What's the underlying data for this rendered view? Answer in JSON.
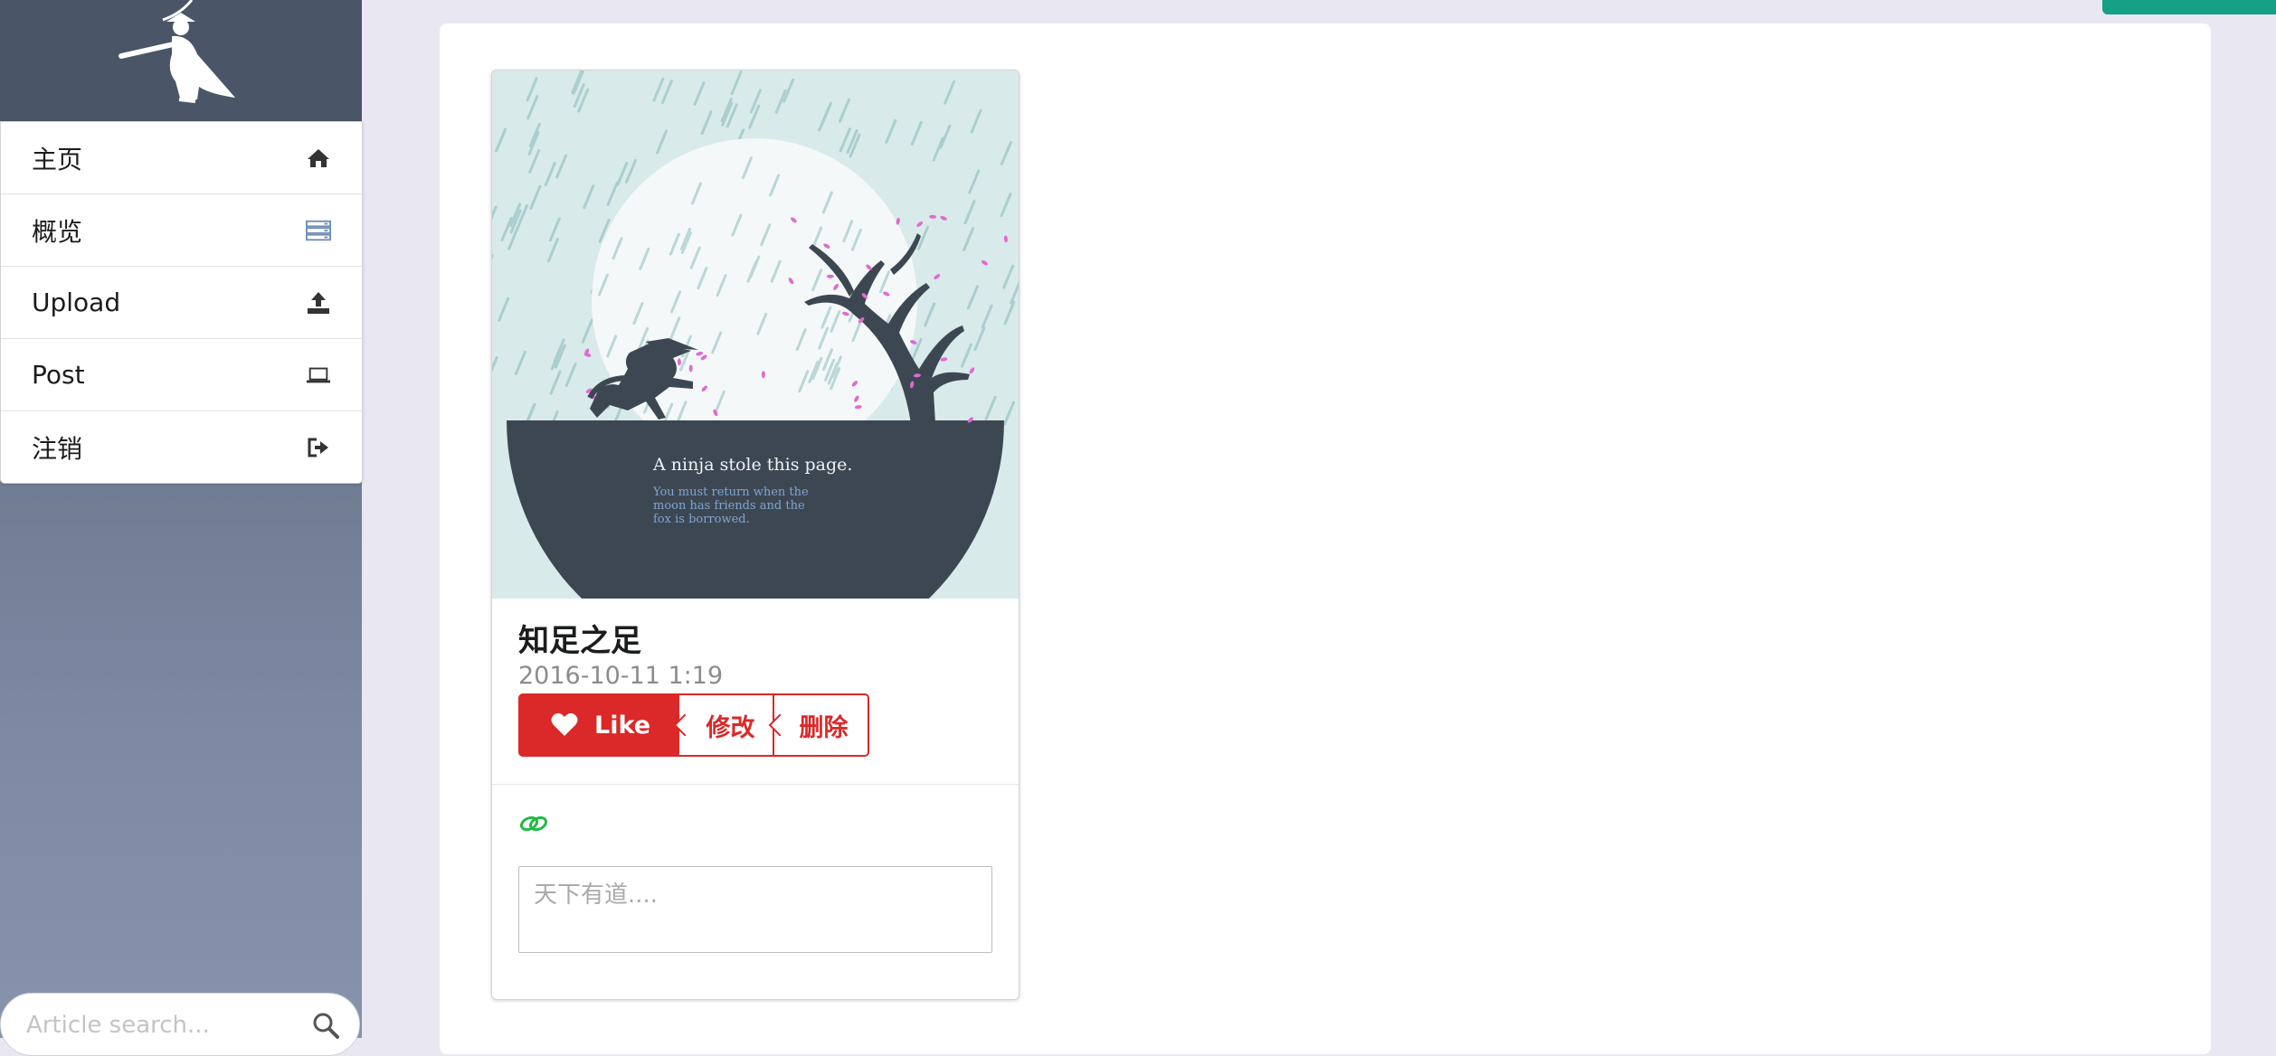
{
  "sidebar": {
    "items": [
      {
        "label": "主页",
        "icon": "home-icon"
      },
      {
        "label": "概览",
        "icon": "list-icon"
      },
      {
        "label": "Upload",
        "icon": "upload-icon"
      },
      {
        "label": "Post",
        "icon": "laptop-icon"
      },
      {
        "label": "注销",
        "icon": "sign-out-icon"
      }
    ],
    "search": {
      "placeholder": "Article search...",
      "icon": "search-icon"
    }
  },
  "card": {
    "image": {
      "line1": "A ninja stole this page.",
      "line2": "You must return when the",
      "line3": "moon has friends and the",
      "line4": "fox is borrowed."
    },
    "title": "知足之足",
    "date": "2016-10-11 1:19",
    "like_label": "Like",
    "edit_label": "修改",
    "delete_label": "删除",
    "comment_placeholder": "天下有道....",
    "link_icon": "link-icon"
  },
  "colors": {
    "accent_red": "#db2828",
    "top_button_green": "#16a085",
    "sidebar_dark": "#4a5667",
    "background": "#e9e8f2"
  }
}
